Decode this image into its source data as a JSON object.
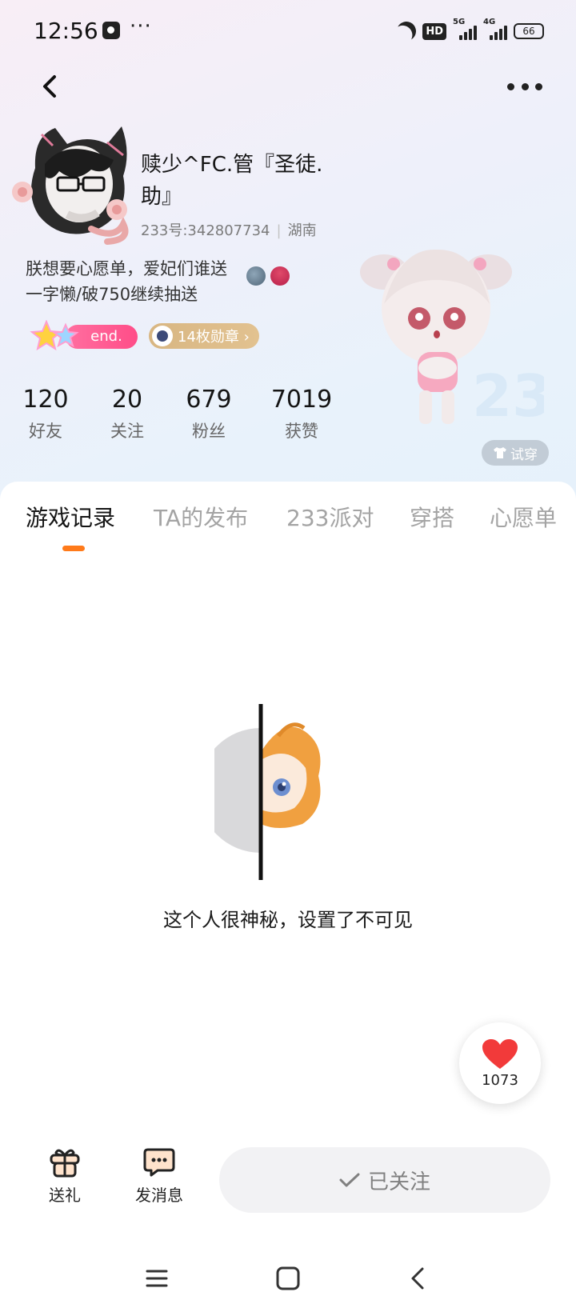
{
  "status_bar": {
    "time": "12:56",
    "more": "···",
    "hd_label": "HD",
    "net1_label": "5G",
    "net2_label": "4G",
    "battery": "66"
  },
  "header": {
    "back_icon": "back-arrow-icon",
    "more_icon": "more-dots-icon"
  },
  "profile": {
    "username": "赎少^FC.管『圣徒.助』",
    "uid_label": "233号:342807734",
    "region": "湖南",
    "bio": "朕想要心愿单，爱妃们谁送\n一字懒/破750继续抽送",
    "badge_text": "end.",
    "medal_text": "14枚勋章 ›",
    "try_on": "试穿"
  },
  "stats": [
    {
      "value": "120",
      "label": "好友"
    },
    {
      "value": "20",
      "label": "关注"
    },
    {
      "value": "679",
      "label": "粉丝"
    },
    {
      "value": "7019",
      "label": "获赞"
    }
  ],
  "tabs": [
    {
      "label": "游戏记录",
      "active": true
    },
    {
      "label": "TA的发布",
      "active": false
    },
    {
      "label": "233派对",
      "active": false
    },
    {
      "label": "穿搭",
      "active": false
    },
    {
      "label": "心愿单",
      "active": false
    }
  ],
  "empty_state": {
    "message": "这个人很神秘，设置了不可见"
  },
  "like": {
    "count": "1073"
  },
  "bottom_bar": {
    "gift_label": "送礼",
    "message_label": "发消息",
    "follow_label": "已关注"
  },
  "colors": {
    "accent": "#ff7a1a",
    "heart": "#f23a3a",
    "badge_pink": "#ff4d88",
    "medal_gold": "#d8b682"
  }
}
